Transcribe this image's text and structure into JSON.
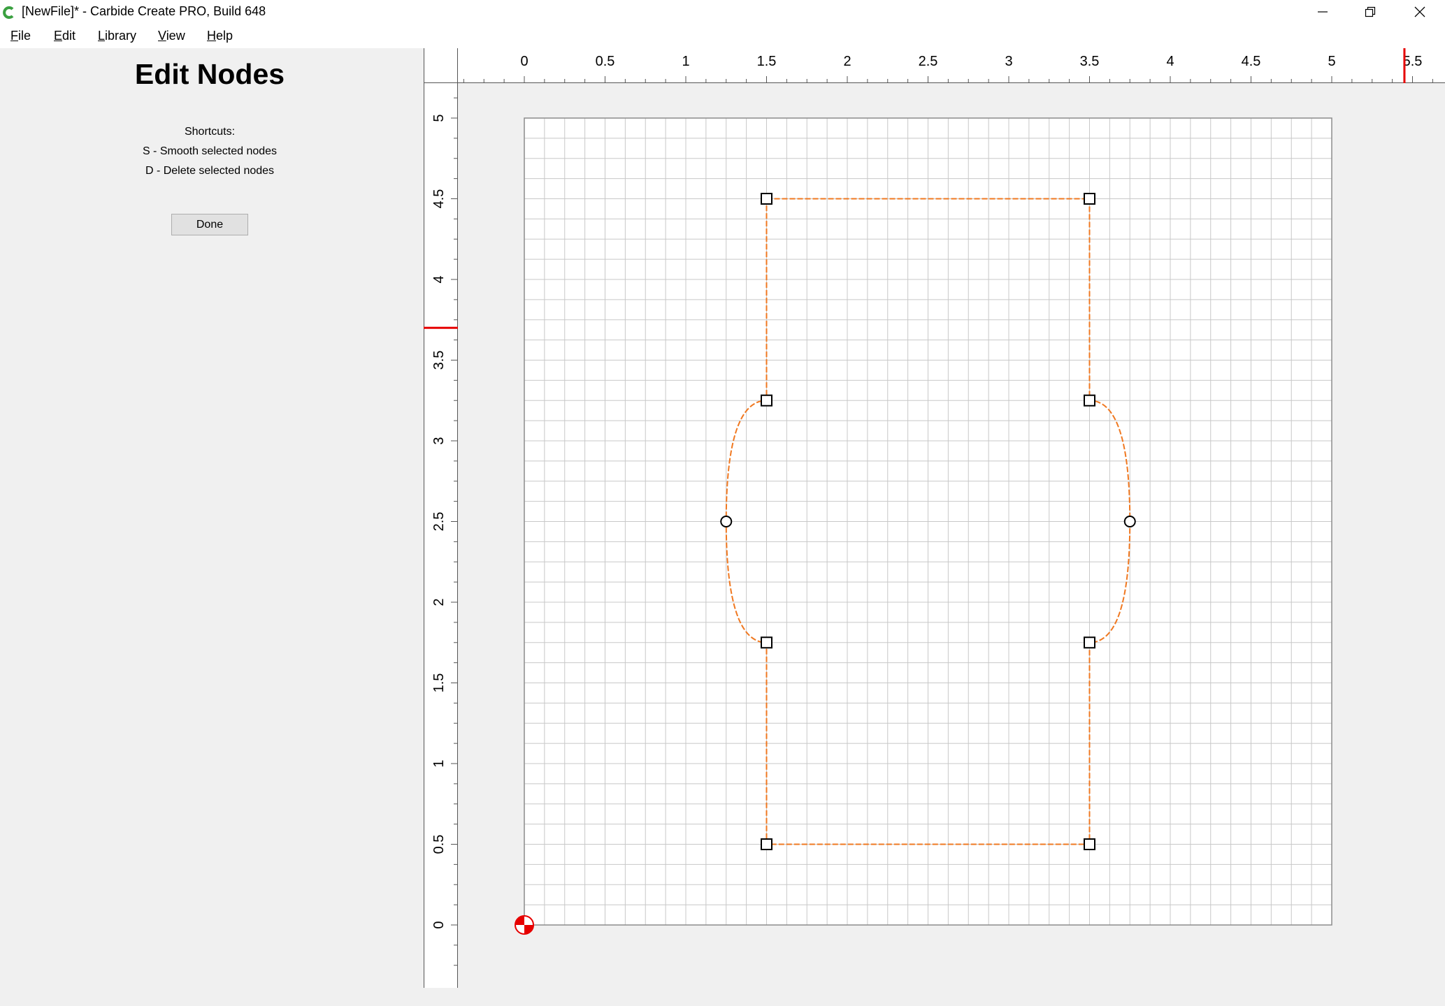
{
  "window": {
    "title": "[NewFile]* - Carbide Create PRO, Build 648",
    "app_icon": "carbide-logo-icon",
    "controls": [
      "minimize-icon",
      "restore-icon",
      "close-icon"
    ]
  },
  "menu": {
    "items": [
      {
        "label": "File"
      },
      {
        "label": "Edit"
      },
      {
        "label": "Library"
      },
      {
        "label": "View"
      },
      {
        "label": "Help"
      }
    ]
  },
  "panel": {
    "title": "Edit Nodes",
    "shortcuts_heading": "Shortcuts:",
    "shortcut_1": "S - Smooth selected nodes",
    "shortcut_2": "D - Delete selected nodes",
    "done_label": "Done"
  },
  "rulers": {
    "horizontal_labels": [
      "0",
      "0.5",
      "1",
      "1.5",
      "2",
      "2.5",
      "3",
      "3.5",
      "4",
      "4.5",
      "5",
      "5.5"
    ],
    "vertical_labels": [
      "0",
      "0.5",
      "1",
      "1.5",
      "2",
      "2.5",
      "3",
      "3.5",
      "4",
      "4.5",
      "5"
    ],
    "cursor_x": 5.45,
    "cursor_y": 3.7,
    "cursor_color": "#e60000"
  },
  "workspace": {
    "width": 5,
    "height": 5,
    "grid_step": 0.125,
    "grid_color": "#c8c8c8",
    "border_color": "#8c8c8c",
    "origin_icon": "origin-marker-icon"
  },
  "shape": {
    "stroke_color": "#f07820",
    "nodes": [
      {
        "x": 1.5,
        "y": 4.5,
        "type": "corner"
      },
      {
        "x": 3.5,
        "y": 4.5,
        "type": "corner"
      },
      {
        "x": 3.5,
        "y": 3.25,
        "type": "corner"
      },
      {
        "x": 3.75,
        "y": 2.5,
        "type": "smooth"
      },
      {
        "x": 3.5,
        "y": 1.75,
        "type": "corner"
      },
      {
        "x": 3.5,
        "y": 0.5,
        "type": "corner"
      },
      {
        "x": 1.5,
        "y": 0.5,
        "type": "corner"
      },
      {
        "x": 1.5,
        "y": 1.75,
        "type": "corner"
      },
      {
        "x": 1.25,
        "y": 2.5,
        "type": "smooth"
      },
      {
        "x": 1.5,
        "y": 3.25,
        "type": "corner"
      }
    ]
  }
}
